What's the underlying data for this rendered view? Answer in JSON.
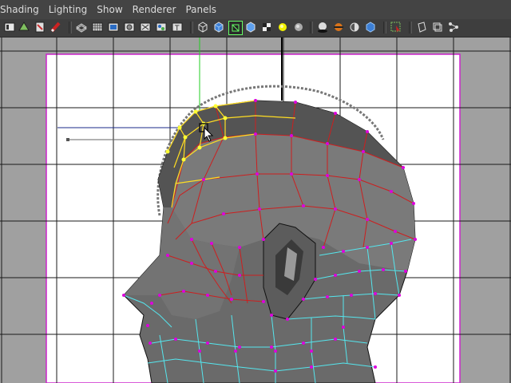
{
  "menu": {
    "items": [
      "Shading",
      "Lighting",
      "Show",
      "Renderer",
      "Panels"
    ]
  },
  "toolbar": {
    "icons": [
      "camera-attributes-icon",
      "select-camera-icon",
      "bookmark-icon",
      "grease-pencil-icon",
      "wireframe-icon",
      "grid-toggle-icon",
      "film-gate-icon",
      "resolution-gate-icon",
      "safe-action-icon",
      "field-chart-icon",
      "safe-title-icon",
      "wireframe-shading-icon",
      "smooth-shade-icon",
      "wireframe-on-shaded-icon",
      "default-material-icon",
      "textured-icon",
      "use-all-lights-icon",
      "default-light-icon",
      "shadows-icon",
      "ambient-occlusion-icon",
      "motion-blur-icon",
      "anti-aliasing-icon",
      "isolate-select-icon",
      "xray-icon",
      "xray-joints-icon",
      "xray-components-icon"
    ],
    "label_t": "T"
  },
  "colors": {
    "viewport_bg": "#a0a0a0",
    "gate_fill": "#ffffff",
    "gate_border": "#cc22cc",
    "selection": "#ffff33",
    "edge_red": "#cc1f1f",
    "edge_cyan": "#55e6ee",
    "vertex": "#dd00dd"
  }
}
